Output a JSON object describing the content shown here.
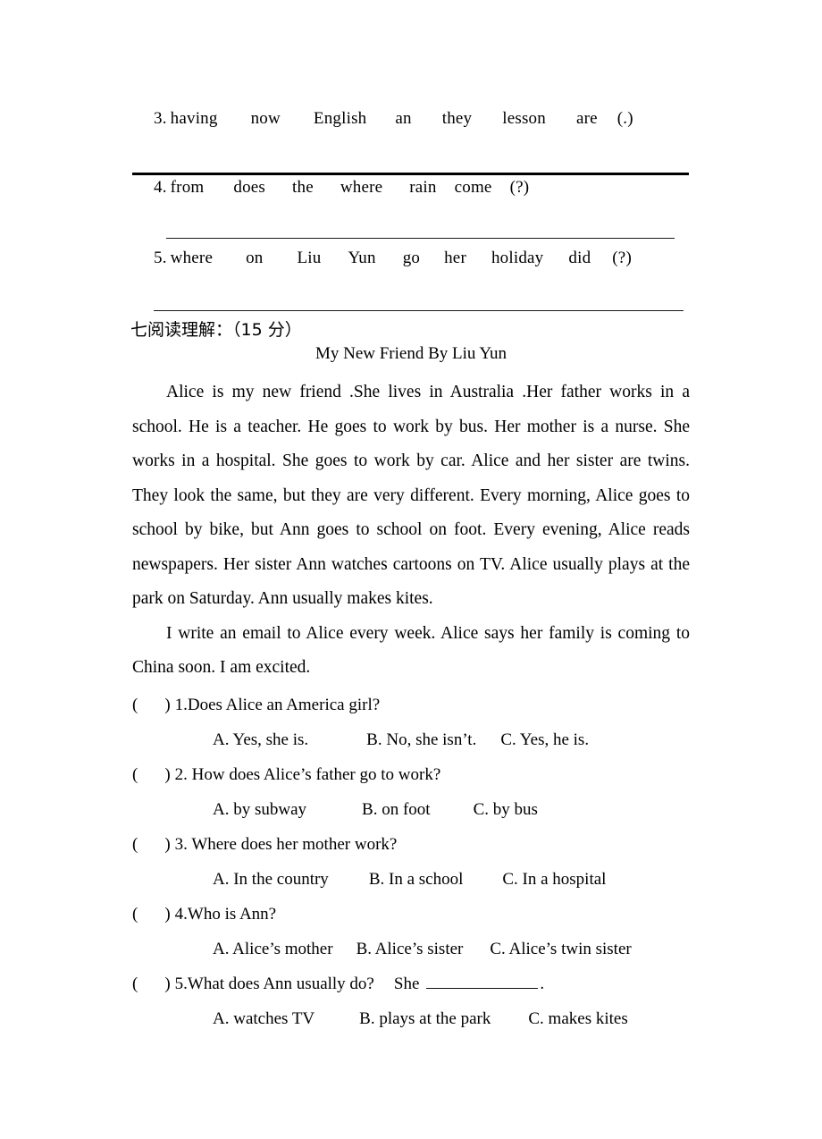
{
  "scramble_items": [
    {
      "number": "3.",
      "words": [
        "having",
        "now",
        "English",
        "an",
        "they",
        "lesson",
        "are",
        "(.)"
      ]
    },
    {
      "number": "4.",
      "words": [
        "from",
        "does",
        "the",
        "where",
        "rain",
        "come",
        "(?)"
      ]
    },
    {
      "number": "5.",
      "words": [
        "where",
        "on",
        "Liu",
        "Yun",
        "go",
        "her",
        "holiday",
        "did",
        "(?)"
      ]
    }
  ],
  "reading_section": {
    "heading": "七阅读理解：（15 分）",
    "passage_title": "My New Friend By Liu Yun",
    "paragraphs": [
      "Alice is my new friend .She lives in Australia .Her father works in a school. He is a teacher. He goes to work by bus. Her mother is a nurse. She works in a hospital. She goes to work by car. Alice and her sister are twins. They look the same, but they are very different. Every morning, Alice goes to school by bike, but Ann goes to school on foot. Every evening, Alice reads newspapers. Her sister Ann watches cartoons on TV. Alice usually plays at the park on Saturday. Ann usually makes kites.",
      "I write an email to Alice every week. Alice says her family is coming to China soon. I am excited."
    ],
    "questions": [
      {
        "paren_open": "(",
        "paren_close": ")",
        "text": "1.Does Alice an America girl?",
        "options": [
          "A. Yes, she is.",
          "B. No, she isn’t.",
          "C. Yes, he is."
        ]
      },
      {
        "paren_open": "(",
        "paren_close": ")",
        "text": "2. How does Alice’s father go to work?",
        "options": [
          "A. by subway",
          "B. on foot",
          "C. by bus"
        ]
      },
      {
        "paren_open": "(",
        "paren_close": ")",
        "text": "3. Where does her mother work?",
        "options": [
          "A. In the country",
          "B. In a school",
          "C. In a hospital"
        ]
      },
      {
        "paren_open": "(",
        "paren_close": ")",
        "text": "4.Who is Ann?",
        "options": [
          "A. Alice’s mother",
          "B. Alice’s sister",
          "C. Alice’s twin sister"
        ]
      },
      {
        "paren_open": "(",
        "paren_close": ")",
        "text": "5.What does Ann usually do?",
        "text_after_blank_prefix": "She",
        "text_after_blank_suffix": ".",
        "options": [
          "A. watches TV",
          "B. plays at the park",
          "C. makes kites"
        ]
      }
    ]
  }
}
